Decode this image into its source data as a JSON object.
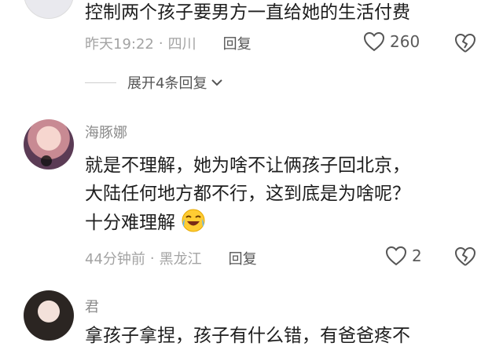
{
  "comment1": {
    "text": "控制两个孩子要男方一直给她的生活付费",
    "time": "昨天19:22",
    "location": "四川",
    "reply_label": "回复",
    "like_count": "260"
  },
  "expand_replies": {
    "label": "展开4条回复"
  },
  "comment2": {
    "username": "海豚娜",
    "line1": "就是不理解，她为啥不让俩孩子回北京，",
    "line2": "大陆任何地方都不行，这到底是为啥呢？",
    "line3": "十分难理解",
    "time": "44分钟前",
    "location": "黑龙江",
    "reply_label": "回复",
    "like_count": "2"
  },
  "comment3": {
    "username": "君",
    "line1": "拿孩子拿捏，孩子有什么错，有爸爸疼不"
  },
  "colors": {
    "text": "#1e1e1e",
    "muted": "#a3a3a3",
    "icon": "#5a5a5a"
  },
  "icons": [
    "heart-icon",
    "broken-heart-icon",
    "chevron-down-icon",
    "laugh-cry-emoji"
  ]
}
